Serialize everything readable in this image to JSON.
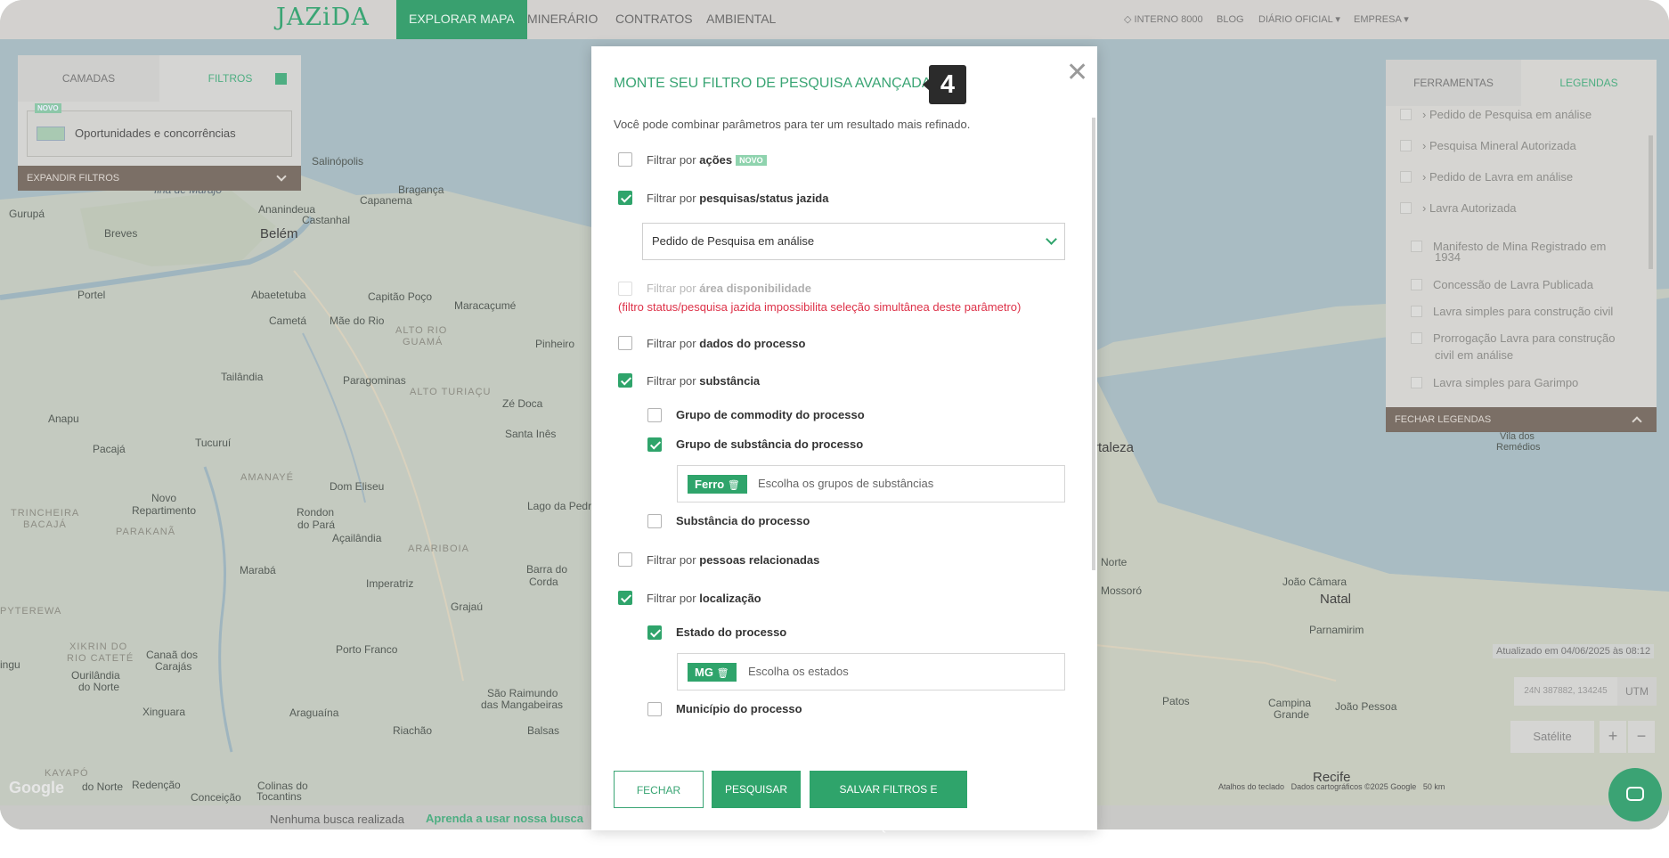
{
  "nav": {
    "logo": "JAZiDA",
    "items": [
      "EXPLORAR MAPA",
      "MINERÁRIO",
      "CONTRATOS",
      "AMBIENTAL"
    ],
    "right": {
      "interno": "INTERNO 8000",
      "blog": "BLOG",
      "diario": "DIÁRIO OFICIAL",
      "empresa": "EMPRESA"
    }
  },
  "left_panel": {
    "tab_layers": "CAMADAS",
    "tab_filters": "FILTROS",
    "novo": "NOVO",
    "toggle_label": "Oportunidades e concorrências",
    "expand": "EXPANDIR FILTROS"
  },
  "right_panel": {
    "tab_tools": "FERRAMENTAS",
    "tab_legends": "LEGENDAS",
    "legends": [
      "Pedido de Pesquisa em análise",
      "Pesquisa Mineral Autorizada",
      "Pedido de Lavra em análise",
      "Lavra Autorizada",
      "Manifesto de Mina Registrado em",
      "1934",
      "Concessão de Lavra Publicada",
      "Lavra simples para construção civil",
      "Prorrogação Lavra para construção",
      "civil em análise",
      "Lavra simples para Garimpo"
    ],
    "close": "FECHAR LEGENDAS"
  },
  "map": {
    "updated": "Atualizado em 04/06/2025 às 08:12",
    "coords": "24N 387882, 134245",
    "utm": "UTM",
    "satellite": "Satélite",
    "zoom_in": "+",
    "zoom_out": "−",
    "google": "Google",
    "attribution": [
      "Atalhos do teclado",
      "Dados cartográficos ©2025 Google",
      "50 km"
    ],
    "labels": {
      "belem": "Belém",
      "ilha": "Ilha de Marajó",
      "salinopolis": "Salinópolis",
      "braganca": "Bragança",
      "capanema": "Capanema",
      "castanhal": "Castanhal",
      "ananindeua": "Ananindeua",
      "gurupa": "Gurupá",
      "breves": "Breves",
      "portel": "Portel",
      "abaetetuba": "Abaetetuba",
      "capitao": "Capitão Poço",
      "maracacume": "Maracaçumé",
      "cameta": "Cametá",
      "mae": "Mãe do Rio",
      "alto_rio": "ALTO RIO",
      "guama": "GUAMÁ",
      "pinheiro": "Pinheiro",
      "tailandia": "Tailândia",
      "paragominas": "Paragominas",
      "alto_turiacu": "ALTO TURIAÇU",
      "ze_doca": "Zé Doca",
      "anapu": "Anapu",
      "pacaja": "Pacajá",
      "tucurui": "Tucuruí",
      "amanaye": "AMANAYÉ",
      "santa_ines": "Santa Inês",
      "novo_rep": "Novo",
      "novo_rep2": "Repartimento",
      "dom_eliseu": "Dom Eliseu",
      "rondon": "Rondon",
      "rondon2": "do Pará",
      "acailandia": "Açailândia",
      "lago_pedra": "Lago da Pedra",
      "trincheira": "TRINCHEIRA",
      "bacaja": "BACAJÁ",
      "parakana": "PARAKANÃ",
      "arariboia": "ARARIBOIA",
      "maraba": "Marabá",
      "imperatriz": "Imperatriz",
      "grajau": "Grajaú",
      "barra_corda": "Barra do",
      "barra_corda2": "Corda",
      "pyterewa": "PYTEREWA",
      "xikrin": "XIKRIN DO",
      "cateté": "RIO CATETÉ",
      "canaa": "Canaã dos",
      "carajas": "Carajás",
      "porto_franco": "Porto Franco",
      "sao_raimundo": "São Raimundo",
      "mangabeiras": "das Mangabeiras",
      "ourilandia": "Ourilândia",
      "do_norte": "do Norte",
      "xinguara": "Xinguara",
      "araguaina": "Araguaína",
      "balsas": "Balsas",
      "riachao": "Riachão",
      "kayapo": "KAYAPÓ",
      "colinas": "Colinas do",
      "tocantins": "Tocantins",
      "redencao": "Redenção",
      "conceicao": "Conceição",
      "fortaleza": "rtaleza",
      "natal": "Natal",
      "parnamirim": "Parnamirim",
      "mossoro": "Mossoró",
      "joao_camara": "João Câmara",
      "campina": "Campina",
      "grande": "Grande",
      "joao_pessoa": "João Pessoa",
      "patos": "Patos",
      "recife": "Recife",
      "vilas": "Vila dos",
      "remedios": "Remédios",
      "norte": "Norte",
      "ingu": "ingu",
      "cutia": "cu"
    }
  },
  "modal": {
    "title": "MONTE SEU FILTRO DE PESQUISA AVANÇADA",
    "step": "4",
    "close": "✕",
    "subtitle": "Você pode combinar parâmetros para ter um resultado mais refinado.",
    "filter_prefix": "Filtrar por",
    "options": {
      "acoes": "ações",
      "acoes_badge": "NOVO",
      "pesquisas": "pesquisas/status jazida",
      "area": "área disponibilidade",
      "dados": "dados do processo",
      "substancia": "substância",
      "pessoas": "pessoas relacionadas",
      "localizacao": "localização"
    },
    "status_select": "Pedido de Pesquisa em análise",
    "warning": "(filtro status/pesquisa jazida impossibilita seleção simultânea deste parâmetro)",
    "sub_substancia": {
      "commodity": "Grupo de commodity do processo",
      "grupo": "Grupo de substância do processo",
      "tag": "Ferro",
      "placeholder": "Escolha os grupos de substâncias",
      "substancia": "Substância do processo"
    },
    "sub_localizacao": {
      "estado": "Estado do processo",
      "tag": "MG",
      "placeholder": "Escolha os estados",
      "municipio": "Município do processo"
    },
    "buttons": {
      "close": "FECHAR",
      "search": "PESQUISAR",
      "save": "SALVAR FILTROS E PESQUISAR"
    }
  },
  "footer": {
    "no_search": "Nenhuma busca realizada",
    "learn": "Aprenda a usar nossa busca"
  },
  "colors": {
    "brand": "#2fa46b",
    "warning": "#dd3148",
    "overlay_nav": "#d3d1cf"
  }
}
